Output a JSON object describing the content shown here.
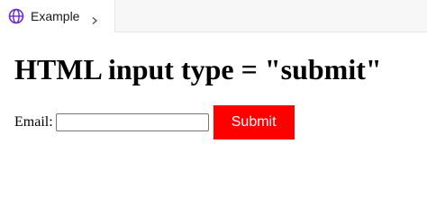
{
  "browser": {
    "tab": {
      "label": "Example",
      "icon": "globe-icon",
      "icon_color": "#6b2ac9"
    }
  },
  "page": {
    "heading": "HTML input type = \"submit\"",
    "form": {
      "email_label": "Email:",
      "email_value": "",
      "email_placeholder": "",
      "submit_label": "Submit",
      "submit_color": "#ff0000"
    }
  }
}
